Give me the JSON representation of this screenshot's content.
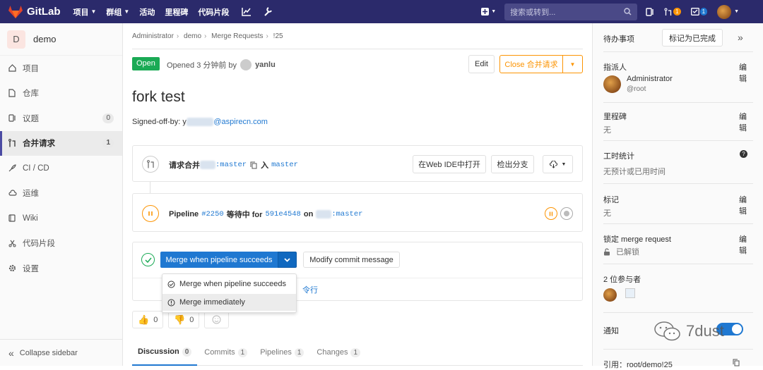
{
  "topbar": {
    "brand": "GitLab",
    "nav": [
      "项目",
      "群组",
      "活动",
      "里程碑",
      "代码片段"
    ],
    "search_placeholder": "搜索或转到...",
    "mr_badge": "1",
    "todo_badge": "1"
  },
  "sidebar": {
    "project_initial": "D",
    "project_name": "demo",
    "items": [
      {
        "label": "项目",
        "icon": "home-icon"
      },
      {
        "label": "仓库",
        "icon": "doc-icon"
      },
      {
        "label": "议题",
        "icon": "issues-icon",
        "count": "0"
      },
      {
        "label": "合并请求",
        "icon": "merge-request-icon",
        "count": "1"
      },
      {
        "label": "CI / CD",
        "icon": "rocket-icon"
      },
      {
        "label": "运维",
        "icon": "cloud-icon"
      },
      {
        "label": "Wiki",
        "icon": "book-icon"
      },
      {
        "label": "代码片段",
        "icon": "scissors-icon"
      },
      {
        "label": "设置",
        "icon": "gear-icon"
      }
    ],
    "collapse": "Collapse sidebar"
  },
  "main": {
    "breadcrumb": [
      "Administrator",
      "demo",
      "Merge Requests",
      "!25"
    ],
    "status": "Open",
    "opened_text": "Opened 3 分钟前 by",
    "author": "yanlu",
    "edit": "Edit",
    "close": "Close 合并请求",
    "title": "fork test",
    "signed_prefix": "Signed-off-by: y",
    "signed_email": "@aspirecn.com",
    "widget": {
      "request_prefix": "请求合并",
      "source_branch": ":master",
      "into": "入",
      "target_branch": "master",
      "web_ide": "在Web IDE中打开",
      "checkout": "检出分支"
    },
    "pipeline": {
      "label": "Pipeline",
      "id": "#2250",
      "status_text": "等待中 for",
      "commit": "591e4548",
      "on": "on",
      "branch": ":master"
    },
    "merge": {
      "button": "Merge when pipeline succeeds",
      "modify": "Modify commit message",
      "dropdown": [
        "Merge when pipeline succeeds",
        "Merge immediately"
      ],
      "hidden_link": "令行"
    },
    "reactions": {
      "thumbs_up": "0",
      "thumbs_down": "0"
    },
    "tabs": [
      {
        "label": "Discussion",
        "count": "0"
      },
      {
        "label": "Commits",
        "count": "1"
      },
      {
        "label": "Pipelines",
        "count": "1"
      },
      {
        "label": "Changes",
        "count": "1"
      }
    ]
  },
  "right": {
    "todo": "待办事项",
    "mark_done": "标记为已完成",
    "assignee_label": "指派人",
    "assignee_name": "Administrator",
    "assignee_user": "@root",
    "edit": "编辑",
    "milestone_label": "里程碑",
    "milestone_value": "无",
    "time_label": "工时统计",
    "time_value": "无预计或已用时间",
    "labels_label": "标记",
    "labels_value": "无",
    "lock_label": "锁定 merge request",
    "lock_value": "已解锁",
    "participants": "2 位参与者",
    "notify": "通知",
    "reference": "引用：root/demo!25"
  },
  "watermark": "7dust",
  "colors": {
    "topbar": "#2b2a6b",
    "open": "#1aaa55",
    "primary": "#1f78d1",
    "warning": "#fc9403"
  }
}
